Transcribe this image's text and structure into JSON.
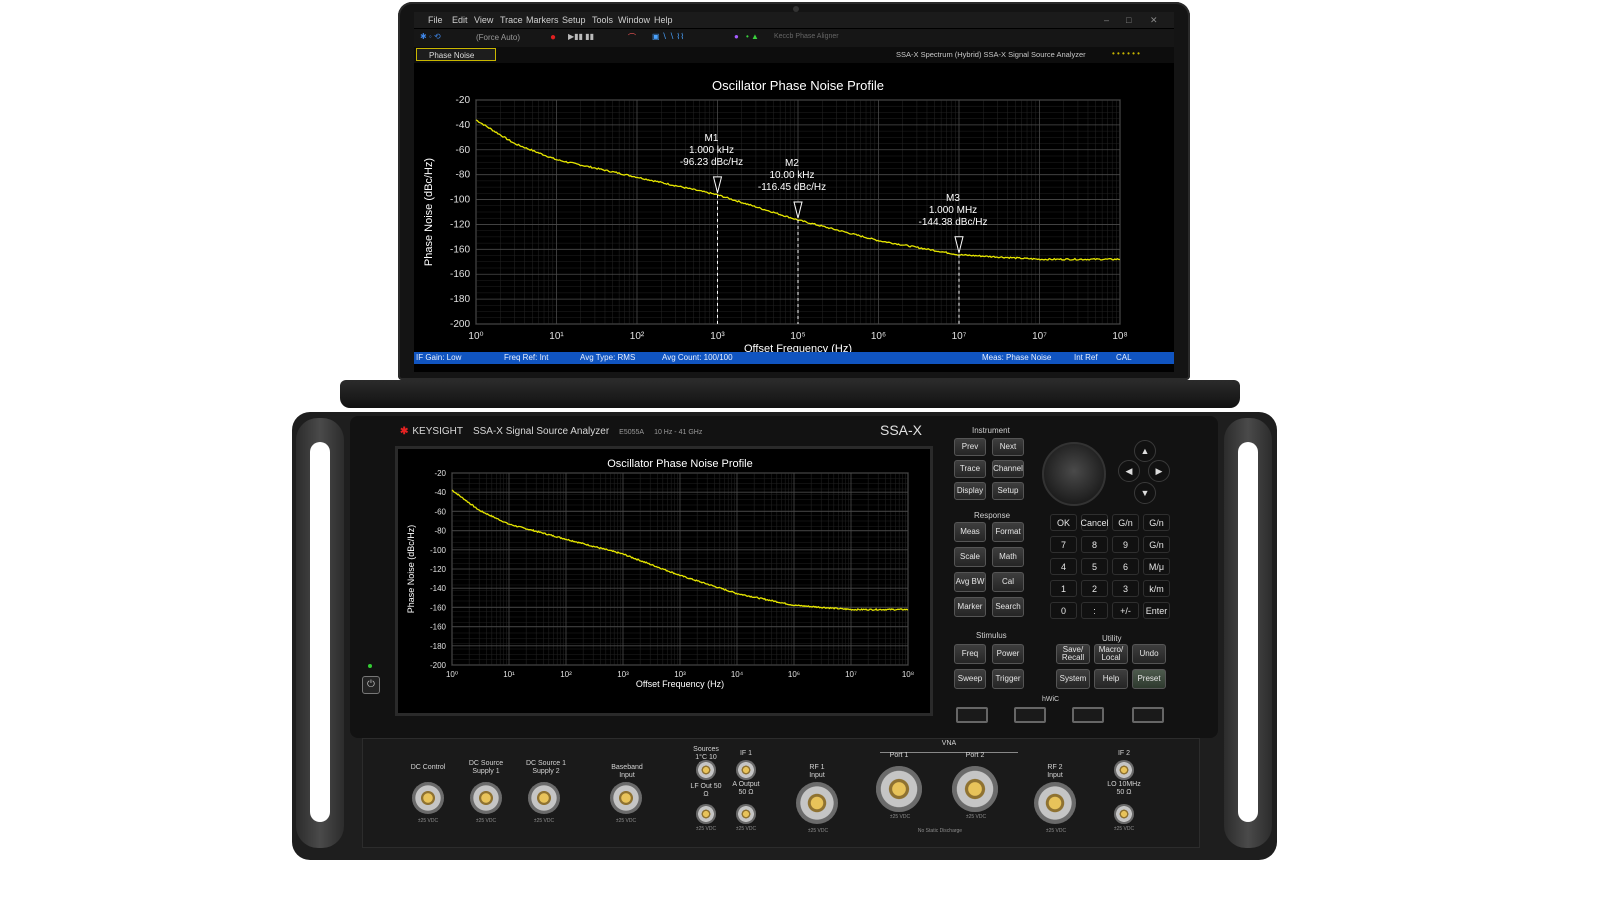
{
  "software": {
    "menu": [
      "File",
      "Edit",
      "View",
      "Trace",
      "Markers",
      "Setup",
      "Tools",
      "Window",
      "Help"
    ],
    "toolbar_mode": "(Force Auto)",
    "toolbar_meas": "Keccb Phase Aligner",
    "window_title": "SSA-X Spectrum (Hybrid)  SSA-X Signal Source Analyzer",
    "active_tab": "Phase Noise",
    "status": {
      "if_gain": "IF Gain: Low",
      "freq_ref": "Freq Ref: Int",
      "avg_type": "Avg Type: RMS",
      "avg_count": "Avg Count: 100/100",
      "meas": "Meas: Phase Noise",
      "int_ref": "Int Ref",
      "cal": "CAL"
    },
    "markers": [
      {
        "name": "M1",
        "freq_label": "1.000 kHz",
        "value_label": "-96.23 dBc/Hz",
        "x": 1000,
        "y": -96.23
      },
      {
        "name": "M2",
        "freq_label": "10.00 kHz",
        "value_label": "-116.45 dBc/Hz",
        "x": 10000,
        "y": -116.45
      },
      {
        "name": "M3",
        "freq_label": "1.000 MHz",
        "value_label": "-144.38 dBc/Hz",
        "x": 1000000,
        "y": -144.38
      }
    ]
  },
  "chart_data": [
    {
      "type": "line",
      "title": "Oscillator Phase Noise Profile",
      "xlabel": "Offset Frequency (Hz)",
      "ylabel": "Phase Noise (dBc/Hz)",
      "x_scale": "log",
      "x_ticks": [
        "10⁰",
        "10¹",
        "10²",
        "10³",
        "10⁵",
        "10⁶",
        "10⁷",
        "10⁷",
        "10⁸"
      ],
      "y_ticks": [
        "-20",
        "-40",
        "-60",
        "-80",
        "-100",
        "-120",
        "-160",
        "-160",
        "-180",
        "-200"
      ],
      "ylim": [
        -200,
        -20
      ],
      "grid": true,
      "series_color": "#e6e600",
      "series": [
        {
          "x": [
            1,
            3,
            10,
            100,
            1000,
            10000,
            100000,
            1000000,
            10000000,
            100000000
          ],
          "y": [
            -36,
            -55,
            -68,
            -82,
            -96.23,
            -116.45,
            -133,
            -144.38,
            -148,
            -148
          ]
        }
      ]
    },
    {
      "type": "line",
      "title": "Oscillator Phase Noise Profile",
      "xlabel": "Offset Frequency (Hz)",
      "ylabel": "Phase Noise (dBc/Hz)",
      "x_scale": "log",
      "x_ticks": [
        "10⁰",
        "10¹",
        "10²",
        "10³",
        "10³",
        "10⁴",
        "10⁶",
        "10⁷",
        "10⁸"
      ],
      "y_ticks": [
        "-20",
        "-40",
        "-60",
        "-80",
        "-100",
        "-120",
        "-140",
        "-160",
        "-160",
        "-180",
        "-200"
      ],
      "ylim": [
        -200,
        -20
      ],
      "grid": true,
      "series_color": "#e6e600",
      "series": [
        {
          "x": [
            1,
            3,
            10,
            100,
            1000,
            10000,
            100000,
            1000000,
            10000000,
            100000000
          ],
          "y": [
            -36,
            -55,
            -68,
            -82,
            -96,
            -116,
            -133,
            -144,
            -148,
            -148
          ]
        }
      ]
    }
  ],
  "instrument": {
    "brand": "KEYSIGHT",
    "model_name": "SSA-X Signal Source Analyzer",
    "model_number": "E5055A",
    "freq_range": "10 Hz - 41 GHz",
    "badge": "SSA-X",
    "groups": {
      "instrument": "Instrument",
      "response": "Response",
      "stimulus": "Stimulus",
      "utility": "Utility",
      "usb": "hWiC"
    },
    "instrument_keys": [
      "Prev",
      "Next",
      "Trace",
      "Channel",
      "Display",
      "Setup"
    ],
    "response_keys": [
      "Meas",
      "Format",
      "Scale",
      "Math",
      "Avg BW",
      "Cal",
      "Marker",
      "Search"
    ],
    "stimulus_keys": [
      "Freq",
      "Power",
      "Sweep",
      "Trigger"
    ],
    "utility_keys": [
      "Save/ Recall",
      "Macro/ Local",
      "Undo",
      "System",
      "Help",
      "Preset"
    ],
    "num_keys": [
      "OK",
      "Cancel",
      "G/n",
      "G/n",
      "7",
      "8",
      "9",
      "G/n",
      "4",
      "5",
      "6",
      "M/μ",
      "1",
      "2",
      "3",
      "k/m",
      "0",
      ":",
      "+/-",
      "Enter"
    ],
    "ports": {
      "dc_control": "DC Control",
      "dc_supply_1": "DC Source Supply 1",
      "dc_supply_2": "DC Source 1 Supply 2",
      "baseband": "Baseband Input",
      "sources": "Sources 1°C 10 MHz",
      "lf_out": "LF Out 50 Ω",
      "if1": "IF 1",
      "a_output": "A Output 50 Ω",
      "rf1": "RF 1 Input",
      "vna": "VNA",
      "port1": "Port 1",
      "port2": "Port 2",
      "rf2": "RF 2 Input",
      "if2": "IF 2",
      "lo": "LO 10MHz 50 Ω",
      "esd": "No Static Discharge"
    },
    "ratings": {
      "dc_control": "±25 VDC",
      "dc_supply_1": "±25 VDC",
      "dc_supply_2": "±25 VDC",
      "baseband": "±25 VDC",
      "lf_out": "±25 VDC",
      "a_output": "±25 VDC",
      "rf1": "±25 VDC",
      "port1": "±25 VDC",
      "port2": "±25 VDC",
      "rf2": "±25 VDC",
      "if2": "±25 VDC"
    }
  }
}
